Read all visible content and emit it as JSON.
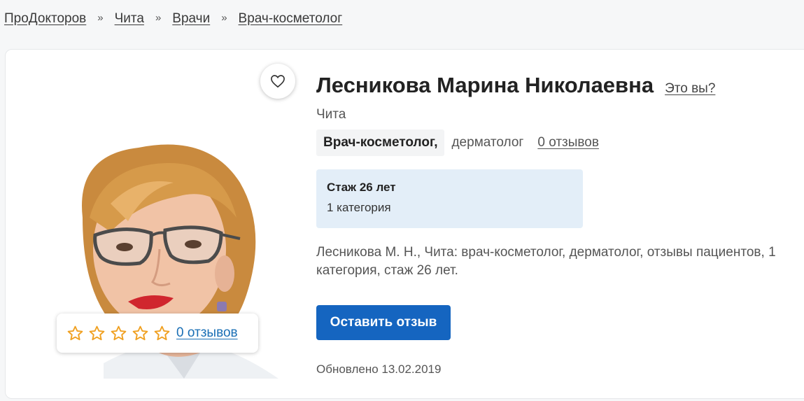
{
  "breadcrumb": [
    "ПроДокторов",
    "Чита",
    "Врачи",
    "Врач-косметолог"
  ],
  "breadcrumb_separator": "»",
  "doctor": {
    "name": "Лесникова Марина Николаевна",
    "who_link": "Это вы?",
    "city": "Чита",
    "spec_main": "Врач-косметолог,",
    "spec_sub": "дерматолог",
    "reviews_link": "0 отзывов",
    "experience": "Стаж 26 лет",
    "category": "1 категория",
    "description_line1": "Лесникова М. Н., Чита: врач-косметолог, дерматолог, отзывы пациентов, 1",
    "description_line2": "категория, стаж 26 лет.",
    "leave_review_button": "Оставить отзыв",
    "updated": "Обновлено 13.02.2019"
  },
  "rating": {
    "stars_filled": 0,
    "stars_total": 5,
    "reviews_link": "0 отзывов"
  },
  "icons": {
    "favorite": "heart-outline-icon",
    "star": "star-outline-icon"
  },
  "colors": {
    "accent": "#1565c0",
    "star": "#f0a020",
    "info_bg": "#e3eef8",
    "link": "#1a6fb5"
  }
}
